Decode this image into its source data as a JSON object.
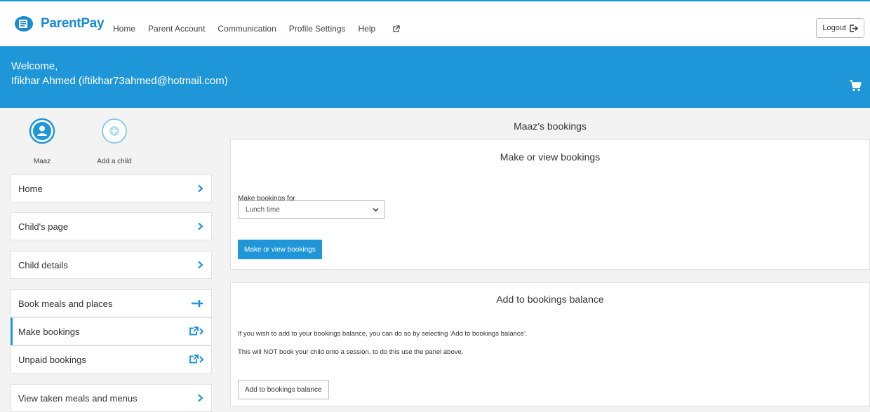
{
  "header": {
    "brand": "ParentPay",
    "nav": [
      "Home",
      "Parent Account",
      "Communication",
      "Profile Settings",
      "Help"
    ],
    "logout_label": "Logout"
  },
  "welcome": {
    "greeting": "Welcome,",
    "user": "Ifikhar Ahmed (iftikhar73ahmed@hotmail.com)"
  },
  "children": {
    "selected_child": "Maaz",
    "add_child_label": "Add a child"
  },
  "sidebar": {
    "items": [
      {
        "label": "Home",
        "icon": "chevron-right-icon"
      },
      {
        "label": "Child's page",
        "icon": "chevron-right-icon"
      },
      {
        "label": "Child details",
        "icon": "chevron-right-icon"
      },
      {
        "label": "Book meals and places",
        "icon": "plus-icon"
      },
      {
        "label": "Make bookings",
        "icon": "external-link-icon",
        "active": true
      },
      {
        "label": "Unpaid bookings",
        "icon": "external-link-icon"
      },
      {
        "label": "View taken meals and menus",
        "icon": "chevron-right-icon"
      }
    ]
  },
  "main": {
    "title": "Maaz's bookings",
    "make_panel": {
      "heading": "Make or view bookings",
      "field_label": "Make bookings for",
      "select_value": "Lunch time",
      "button_label": "Make or view bookings"
    },
    "balance_panel": {
      "heading": "Add to bookings balance",
      "line1": "If you wish to add to your bookings balance, you can do so by selecting 'Add to bookings balance'.",
      "line2": "This will NOT book your child onto a session, to do this use the panel above.",
      "button_label": "Add to bookings balance"
    }
  },
  "colors": {
    "brand_blue": "#1e96d8",
    "logo_blue": "#1a8ccc",
    "active_marker": "#1e96d8"
  }
}
